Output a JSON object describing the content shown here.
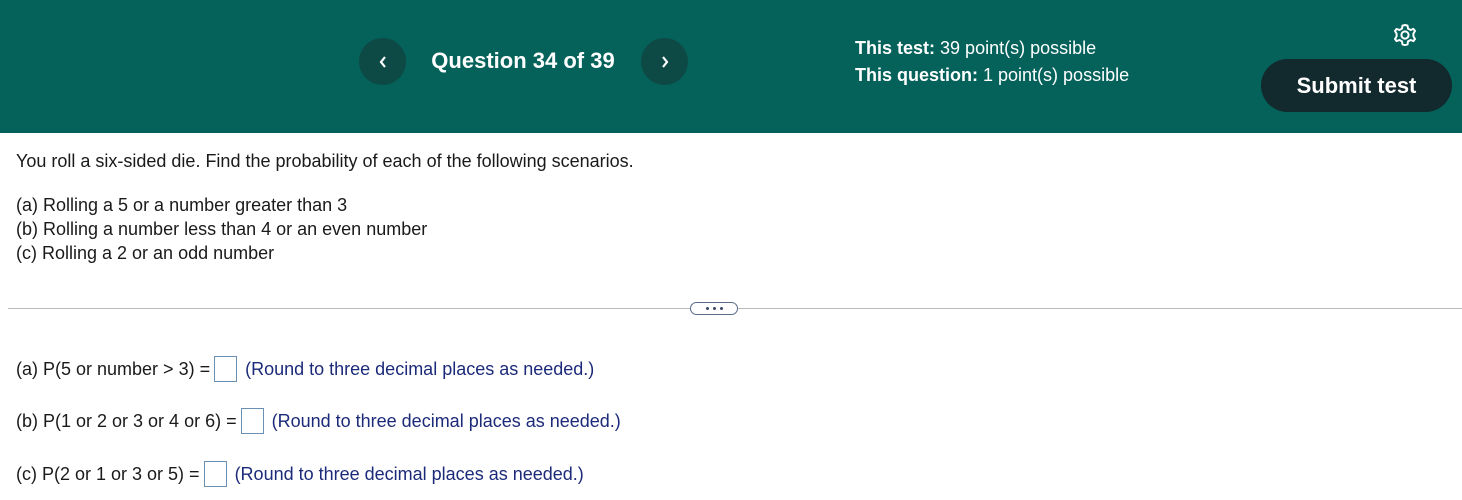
{
  "header": {
    "question_title": "Question 34 of 39",
    "prev_icon": "chevron-left-icon",
    "next_icon": "chevron-right-icon",
    "test_label": "This test:",
    "test_value": "39 point(s) possible",
    "question_label": "This question:",
    "question_value": "1 point(s) possible",
    "settings_icon": "gear-icon",
    "submit_label": "Submit test",
    "bg_color": "#04625a",
    "submit_color": "#12292e"
  },
  "question": {
    "intro": "You roll a six-sided die. Find the probability of each of the following scenarios.",
    "parts": [
      "(a) Rolling a 5 or a number greater than 3",
      "(b) Rolling a number less than 4 or an even number",
      "(c) Rolling a 2 or an odd number"
    ]
  },
  "more_icon": "ellipsis-icon",
  "answers": [
    {
      "label": "(a) P(5 or number > 3) =",
      "value": "",
      "hint": "(Round to three decimal places as needed.)"
    },
    {
      "label": "(b) P(1 or 2 or 3 or 4 or 6) =",
      "value": "",
      "hint": "(Round to three decimal places as needed.)"
    },
    {
      "label": "(c) P(2 or 1 or 3 or 5)  =",
      "value": "",
      "hint": "(Round to three decimal places as needed.)"
    }
  ]
}
